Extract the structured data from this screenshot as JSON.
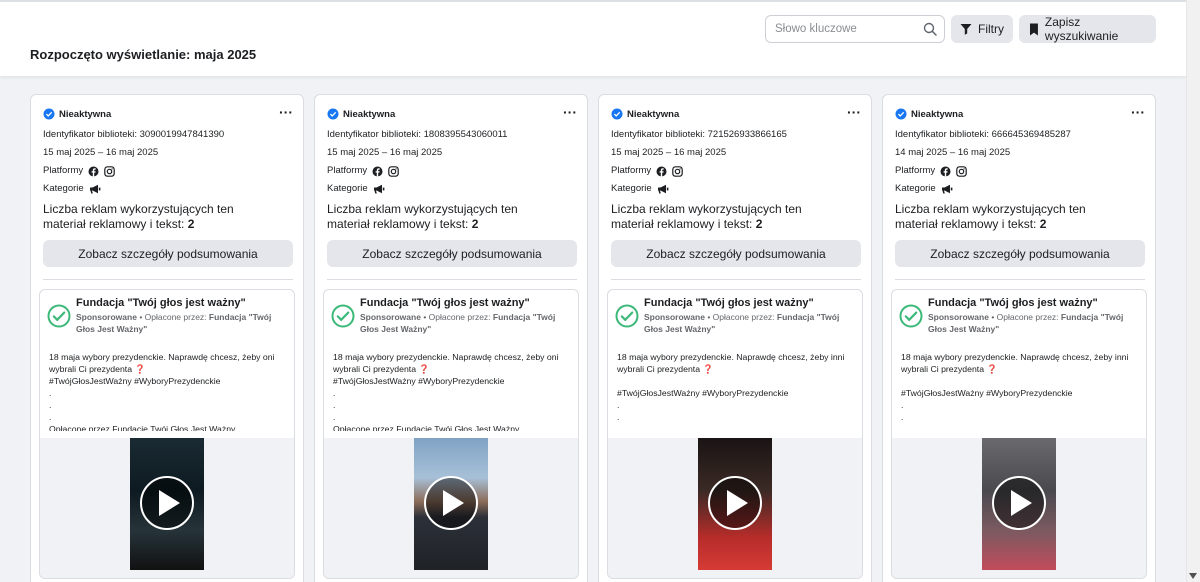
{
  "header": {
    "title": "Rozpoczęto wyświetlanie: maja 2025",
    "search_placeholder": "Słowo kluczowe",
    "filters_label": "Filtry",
    "save_search_label": "Zapisz wyszukiwanie"
  },
  "cards": [
    {
      "status": "Nieaktywna",
      "library_id": "Identyfikator biblioteki: 3090019947841390",
      "dates": "15 maj 2025 – 16 maj 2025",
      "platforms_label": "Platformy",
      "categories_label": "Kategorie",
      "count_text": "Liczba reklam wykorzystujących ten materiał reklamowy i tekst:",
      "count_value": "2",
      "summary_button": "Zobacz szczegóły podsumowania",
      "ad": {
        "page_name": "Fundacja \"Twój głos jest ważny\"",
        "sponsored": "Sponsorowane",
        "paid_by_label": "• Opłacone przez:",
        "paid_by": "Fundacja \"Twój Głos Jest Ważny\"",
        "body": "18 maja wybory prezydenckie. Naprawdę chcesz, żeby oni wybrali Ci prezydenta ❓\n#TwójGłosJestWażny #WyboryPrezydenckie\n.\n.\n.\nOpłacone przez Fundację Twój Głos Jest Ważny."
      }
    },
    {
      "status": "Nieaktywna",
      "library_id": "Identyfikator biblioteki: 1808395543060011",
      "dates": "15 maj 2025 – 16 maj 2025",
      "platforms_label": "Platformy",
      "categories_label": "Kategorie",
      "count_text": "Liczba reklam wykorzystujących ten materiał reklamowy i tekst:",
      "count_value": "2",
      "summary_button": "Zobacz szczegóły podsumowania",
      "ad": {
        "page_name": "Fundacja \"Twój głos jest ważny\"",
        "sponsored": "Sponsorowane",
        "paid_by_label": "• Opłacone przez:",
        "paid_by": "Fundacja \"Twój Głos Jest Ważny\"",
        "body": "18 maja wybory prezydenckie. Naprawdę chcesz, żeby oni wybrali Ci prezydenta ❓\n#TwójGłosJestWażny #WyboryPrezydenckie\n.\n.\n.\nOpłacone przez Fundację Twój Głos Jest Ważny."
      }
    },
    {
      "status": "Nieaktywna",
      "library_id": "Identyfikator biblioteki: 721526933866165",
      "dates": "15 maj 2025 – 16 maj 2025",
      "platforms_label": "Platformy",
      "categories_label": "Kategorie",
      "count_text": "Liczba reklam wykorzystujących ten materiał reklamowy i tekst:",
      "count_value": "2",
      "summary_button": "Zobacz szczegóły podsumowania",
      "ad": {
        "page_name": "Fundacja \"Twój głos jest ważny\"",
        "sponsored": "Sponsorowane",
        "paid_by_label": "• Opłacone przez:",
        "paid_by": "Fundacja \"Twój Głos Jest Ważny\"",
        "body": "18 maja wybory prezydenckie. Naprawdę chcesz, żeby inni wybrali Ci prezydenta ❓\n\n#TwójGłosJestWażny #WyboryPrezydenckie\n.\n.\n..."
      }
    },
    {
      "status": "Nieaktywna",
      "library_id": "Identyfikator biblioteki: 666645369485287",
      "dates": "14 maj 2025 – 16 maj 2025",
      "platforms_label": "Platformy",
      "categories_label": "Kategorie",
      "count_text": "Liczba reklam wykorzystujących ten materiał reklamowy i tekst:",
      "count_value": "2",
      "summary_button": "Zobacz szczegóły podsumowania",
      "ad": {
        "page_name": "Fundacja \"Twój głos jest ważny\"",
        "sponsored": "Sponsorowane",
        "paid_by_label": "• Opłacone przez:",
        "paid_by": "Fundacja \"Twój Głos Jest Ważny\"",
        "body": "18 maja wybory prezydenckie. Naprawdę chcesz, żeby inni wybrali Ci prezydenta ❓\n\n#TwójGłosJestWażny #WyboryPrezydenckie\n.\n.\n..."
      }
    }
  ],
  "icons": {
    "status": "blue-check-icon",
    "platforms": [
      "facebook-icon",
      "instagram-icon"
    ],
    "category": "megaphone-icon",
    "ad_logo": "green-check-logo",
    "media": "play-icon"
  },
  "colors": {
    "accent_blue": "#1877f2",
    "logo_green": "#3cb878"
  }
}
